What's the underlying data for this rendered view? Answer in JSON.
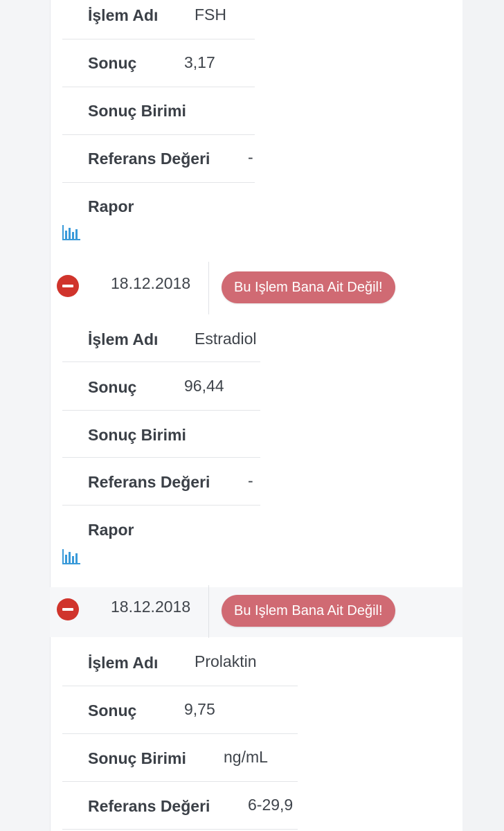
{
  "labels": {
    "islem_adi": "İşlem Adı",
    "sonuc": "Sonuç",
    "sonuc_birimi": "Sonuç Birimi",
    "referans_degeri": "Referans Değeri",
    "rapor": "Rapor"
  },
  "records": [
    {
      "islem_adi": "FSH",
      "sonuc": "3,17",
      "sonuc_birimi": "",
      "referans_degeri": "-"
    },
    {
      "date": "18.12.2018",
      "button": "Bu Işlem Bana Ait Değil!",
      "islem_adi": "Estradiol",
      "sonuc": "96,44",
      "sonuc_birimi": "",
      "referans_degeri": "-"
    },
    {
      "date": "18.12.2018",
      "button": "Bu Işlem Bana Ait Değil!",
      "islem_adi": "Prolaktin",
      "sonuc": "9,75",
      "sonuc_birimi": "ng/mL",
      "referans_degeri": "6-29,9"
    }
  ],
  "colors": {
    "danger": "#d0342c",
    "button_bg": "#d06a73",
    "chart_icon": "#3a9ad9"
  },
  "icons": {
    "report": "bar-chart-icon",
    "remove": "minus-circle-icon"
  }
}
